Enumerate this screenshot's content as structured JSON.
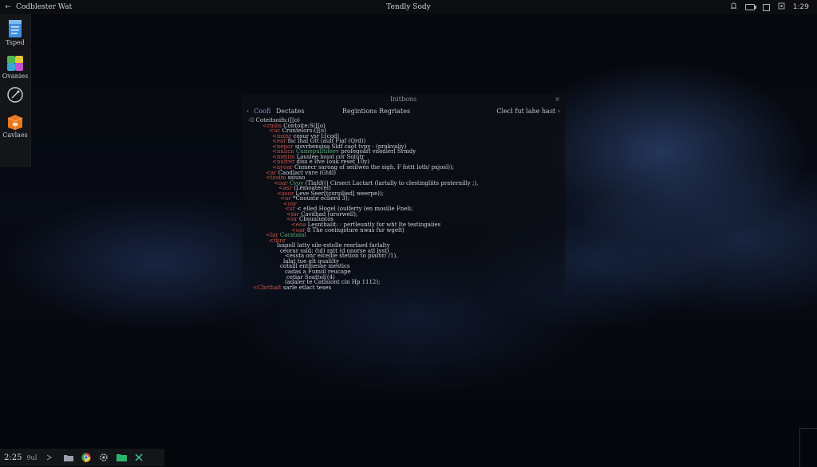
{
  "topbar": {
    "back_glyph": "←",
    "app_title": "Codblester Wat",
    "center_title": "Tendly Sody",
    "clock": "1:29"
  },
  "dock": {
    "items": [
      {
        "label": "Tsped",
        "icon": "file-icon"
      },
      {
        "label": "Ovanies",
        "icon": "apps-icon"
      },
      {
        "label": "",
        "icon": "compass-icon"
      },
      {
        "label": "Cavlaes",
        "icon": "package-icon"
      }
    ]
  },
  "terminal": {
    "title": "Initbons",
    "close": "×",
    "tab_left_chevron": "‹",
    "tab_left_a": "Coofi",
    "tab_left_b": "Dectates",
    "tab_center": "Regintions Regriates",
    "tab_right": "Clecl fut lahe  hast ›",
    "lines": [
      {
        "k": "",
        "g": "‹ll",
        "w": "Coteitsoifs:([[o)"
      },
      {
        "k": "<rmhs",
        "g": "",
        "w": "Contoite:S([[o)"
      },
      {
        "k": "<uc",
        "g": "",
        "w": "Crontelors:([[o)"
      },
      {
        "k": "<mxnr",
        "g": "",
        "w": "cosur vsr l:[cod)"
      },
      {
        "k": "<ear",
        "g": "",
        "w": "fsc lhal Gtt  (aulf Fiaf (Qrd))"
      },
      {
        "k": "<nenor",
        "g": "",
        "w": "sisvrbensisa Sldf caot tvpy · (prakvaliy)"
      },
      {
        "k": "<nulicn",
        "g": "Cumepulltifeev",
        "w": "profegoarl vnedierl Srmdy"
      },
      {
        "k": "<metim",
        "g": "",
        "w": "Lauslee louol cor Solutr"
      },
      {
        "k": "<nufrer",
        "g": "",
        "w": "diss e lfve (ouk reset 10y)"
      },
      {
        "k": "<ayoar",
        "g": "",
        "w": "Cnmecr saroag of seiilwes the sigh, F fottt loth/ pxjosl));"
      },
      {
        "k": "<ar",
        "g": "",
        "w": "Caodlact vnre (Gtdl)"
      },
      {
        "k": "<tosim",
        "g": "",
        "w": "ssiuso"
      },
      {
        "k": "<oar",
        "g": "Cvoy",
        "w": "(Tlafd(() Cirsect Lactart (lartally to clestingliits praternilly ;),"
      },
      {
        "k": "<asr",
        "g": "",
        "w": "(Lemoatecel)"
      },
      {
        "k": "<asor",
        "g": "",
        "w": "Leve  Seer[tcsroilied] weerpe));"
      },
      {
        "k": "<ur",
        "g": "",
        "w": "*Cnouste eclierd 3);"
      },
      {
        "k": "<osr",
        "g": "",
        "w": ""
      },
      {
        "k": "<sr",
        "g": "",
        "w": "< elled  Hogel  (oulferty (en mosilie Fneli;"
      },
      {
        "k": "<mr",
        "g": "",
        "w": "Cavdhad (urorwell);"
      },
      {
        "k": "<nr",
        "g": "",
        "w": "Cbsualustos"
      },
      {
        "k": "<eoa",
        "g": "",
        "w": "Lesnthalit: : pertleuntly for wht lte testingaiies"
      },
      {
        "k": "<oar",
        "g": "",
        "w": "8 The coeingsture nwas fur wgelt)"
      },
      {
        "k": "<lar",
        "g": "Cacstaiol",
        "w": ""
      },
      {
        "k": "<thnr",
        "g": "",
        "w": ""
      },
      {
        "k": "",
        "g": "",
        "w": "lsapoll latty  sile-estolle reerlaed farlalty"
      },
      {
        "k": "",
        "g": "",
        "w": "ceorar ssid; (td) ratt (d onorse atl lyst)"
      },
      {
        "k": "",
        "g": "",
        "w": "<essta onr eicellie stetion to piafor/ /1),"
      },
      {
        "k": "",
        "g": "",
        "w": "lalat tue glt qualilty"
      },
      {
        "k": "",
        "g": "",
        "w": "cotalll entinesae mestics"
      },
      {
        "k": "",
        "g": "",
        "w": "cadas a Fumiil reucape"
      },
      {
        "k": "",
        "g": "",
        "w": "cetiar Soattol((4)"
      },
      {
        "k": "",
        "g": "",
        "w": "(adaler te Catlsiont cin Hp 1112);"
      },
      {
        "k": "<Cbrthalt",
        "g": "",
        "w": "sarle etlact teses"
      }
    ]
  },
  "taskbar": {
    "time": "2:25",
    "sub": "9ul"
  }
}
